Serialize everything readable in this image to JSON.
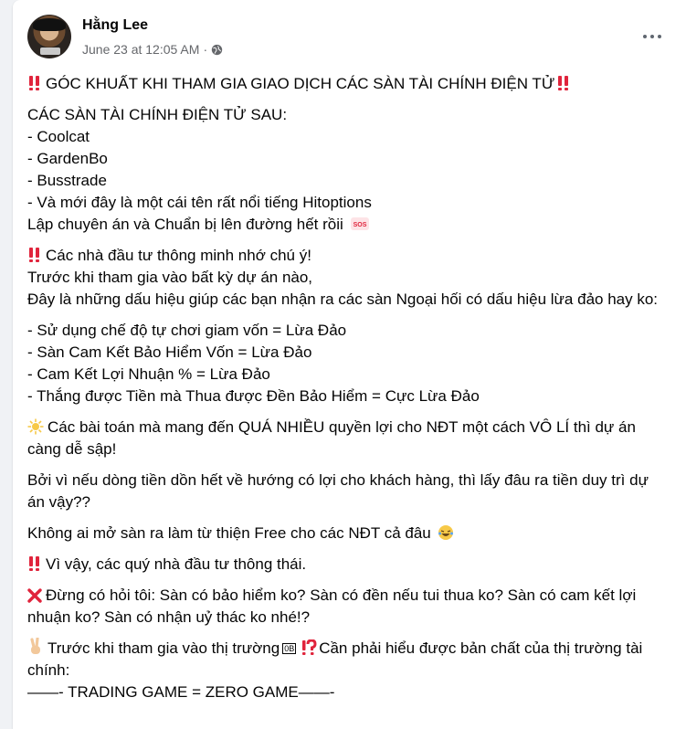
{
  "post": {
    "author": "Hằng Lee",
    "timestamp": "June 23 at 12:05 AM",
    "separator": "·",
    "paragraphs": [
      [
        "GÓC KHUẤT KHI THAM GIA GIAO DỊCH CÁC SÀN TÀI CHÍNH ĐIỆN TỬ"
      ],
      [
        "CÁC SÀN TÀI CHÍNH ĐIỆN TỬ SAU:",
        "- Coolcat",
        "- GardenBo",
        "- Busstrade",
        "- Và mới đây là một cái tên rất nổi tiếng Hitoptions",
        "Lập chuyên án và Chuẩn bị lên đường hết rồii"
      ],
      [
        "Các nhà đầu tư thông minh nhớ chú ý!",
        "Trước khi tham gia vào bất kỳ dự án nào,",
        "Đây là những dấu hiệu giúp các bạn nhận ra các sàn Ngoại hối có dấu hiệu lừa đảo hay ko:"
      ],
      [
        "- Sử dụng chế độ tự chơi giam vốn = Lừa Đảo",
        "- Sàn Cam Kết Bảo Hiểm Vốn = Lừa Đảo",
        "- Cam Kết Lợi Nhuận % = Lừa Đảo",
        "- Thắng được Tiền mà Thua được Đền Bảo Hiểm = Cực Lừa Đảo"
      ],
      [
        "Các bài toán mà mang đến QUÁ NHIỀU quyền lợi cho NĐT một cách VÔ LÍ thì dự án càng dễ sập!"
      ],
      [
        "Bởi vì nếu dòng tiền dồn hết về hướng có lợi cho khách hàng, thì lấy đâu ra tiền duy trì dự án vậy??"
      ],
      [
        "Không ai mở sàn ra làm từ thiện Free cho các NĐT cả đâu"
      ],
      [
        "Vì vậy, các quý nhà đầu tư thông thái."
      ],
      [
        "Đừng có hỏi tôi: Sàn có bảo hiểm ko? Sàn có đền nếu tui thua ko? Sàn có cam kết lợi nhuận ko? Sàn có nhận uỷ thác ko nhé!?"
      ],
      [
        "Trước khi tham gia vào thị trường",
        "Cần phải hiểu được bản chất của thị trường tài chính:"
      ],
      [
        "——- TRADING GAME = ZERO GAME——-"
      ]
    ],
    "sos_label": "SOS",
    "box_glyph": "0B",
    "icons": [
      "double-exclamation-icon",
      "sos-icon",
      "glowing-star-icon",
      "laughing-face-icon",
      "cross-mark-icon",
      "victory-hand-icon",
      "exclamation-question-icon",
      "globe-icon",
      "more-options-icon"
    ]
  },
  "colors": {
    "emoji_red": "#e0243c",
    "text": "#050505",
    "muted": "#65676b",
    "background": "#f0f2f5"
  }
}
